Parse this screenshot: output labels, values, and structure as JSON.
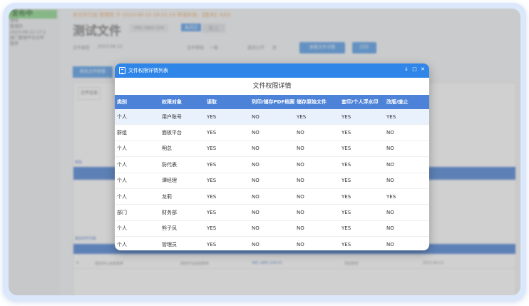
{
  "bg": {
    "status": "发布中",
    "breadcrumb": "本文件已由 管理员 于 2023-06-15 19:51:14 申请失效。【版本】A/01",
    "title": "测试文件",
    "code": "HKC-QBH-104",
    "version": "A/02",
    "version2": "废止",
    "left_lines": [
      "领导",
      "管理员",
      "2023-06-12 17:1",
      "部门管理平台文件",
      "程序"
    ],
    "meta": [
      "文件类型",
      "2023-06-13",
      "文件等级",
      "一般",
      "是否公开",
      "否"
    ],
    "btn_view": "查看文件详情",
    "btn_print": "打印",
    "btn_dept": "相关文件权限",
    "tab": "文件信息",
    "section1": "审批",
    "section2": "相关附件列表",
    "row": [
      "4",
      "测试中心总结表单",
      "测试平台总结表单",
      "HKC-QBH-104-01",
      "测试财务",
      "2023-06-13"
    ]
  },
  "dialog": {
    "title": "文件权限详情列表",
    "controls": [
      "↓",
      "□",
      "✕"
    ],
    "heading": "文件权限详情",
    "columns": [
      "类别",
      "权限对象",
      "读取",
      "列印/储存PDF档案",
      "储存原始文件",
      "套印/个人浮水印",
      "改版/废止"
    ],
    "rows": [
      [
        "个人",
        "用户账号",
        "YES",
        "NO",
        "YES",
        "YES",
        "YES"
      ],
      [
        "群组",
        "面板平台",
        "YES",
        "NO",
        "NO",
        "YES",
        "NO"
      ],
      [
        "个人",
        "明总",
        "YES",
        "NO",
        "NO",
        "YES",
        "NO"
      ],
      [
        "个人",
        "防代表",
        "YES",
        "NO",
        "NO",
        "YES",
        "NO"
      ],
      [
        "个人",
        "谭经理",
        "YES",
        "NO",
        "NO",
        "YES",
        "NO"
      ],
      [
        "个人",
        "龙莉",
        "YES",
        "NO",
        "NO",
        "YES",
        "YES"
      ],
      [
        "部门",
        "财务部",
        "YES",
        "NO",
        "NO",
        "YES",
        "NO"
      ],
      [
        "个人",
        "熊子凤",
        "YES",
        "NO",
        "NO",
        "YES",
        "NO"
      ],
      [
        "个人",
        "管理员",
        "YES",
        "NO",
        "NO",
        "YES",
        "NO"
      ]
    ]
  },
  "colors": {
    "titlebar": "#2f86e8",
    "table_header": "#4d82d9",
    "selected_row": "#e9f1fd"
  }
}
